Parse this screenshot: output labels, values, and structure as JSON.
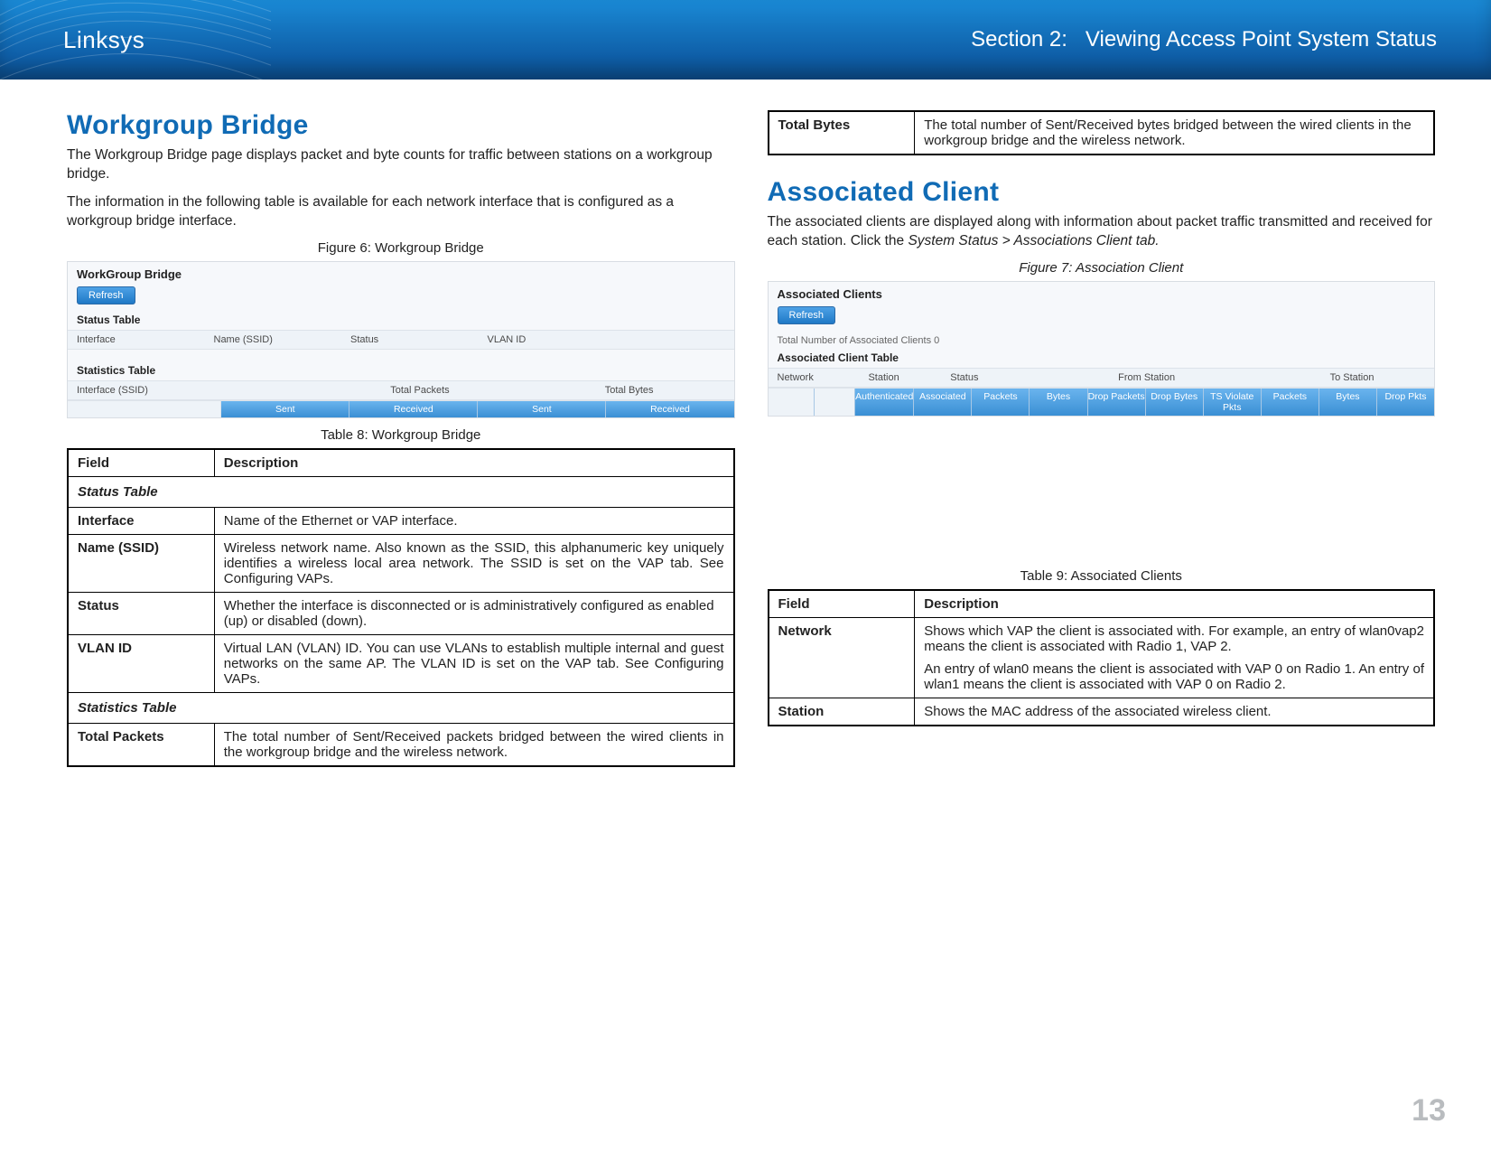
{
  "header": {
    "brand": "Linksys",
    "section_prefix": "Section 2:",
    "section_title": "Viewing Access Point System Status"
  },
  "left": {
    "heading": "Workgroup Bridge",
    "p1": "The Workgroup Bridge page displays packet and byte counts for traffic between stations on a workgroup bridge.",
    "p2": "The information in the following table is available for each network interface that is configured as a workgroup bridge interface.",
    "fig_caption": "Figure 6: Workgroup Bridge",
    "shot": {
      "title": "WorkGroup Bridge",
      "refresh": "Refresh",
      "status_title": "Status Table",
      "cols": {
        "c1": "Interface",
        "c2": "Name (SSID)",
        "c3": "Status",
        "c4": "VLAN ID"
      },
      "stats_title": "Statistics Table",
      "stats_row_label": "Interface (SSID)",
      "stats_h1": "Total Packets",
      "stats_h2": "Total Bytes",
      "pills": {
        "p1": "Sent",
        "p2": "Received",
        "p3": "Sent",
        "p4": "Received"
      }
    },
    "table_caption": "Table 8: Workgroup Bridge",
    "table": {
      "head_field": "Field",
      "head_desc": "Description",
      "section1": "Status Table",
      "rows1": [
        {
          "field": "Interface",
          "desc": "Name of the Ethernet or VAP interface."
        },
        {
          "field": "Name (SSID)",
          "desc": "Wireless network name. Also known as the SSID, this alphanumeric key uniquely identifies a wireless local area network. The SSID is set on the VAP tab. See Configuring VAPs."
        },
        {
          "field": "Status",
          "desc": "Whether the interface is disconnected or is administratively configured as enabled (up) or disabled (down)."
        },
        {
          "field": "VLAN ID",
          "desc": "Virtual LAN (VLAN) ID. You can use VLANs to establish multiple internal and guest networks on the same AP. The VLAN ID is set on the VAP tab. See Configuring VAPs."
        }
      ],
      "section2": "Statistics Table",
      "rows2": [
        {
          "field": "Total Packets",
          "desc": "The total number of Sent/Received packets bridged between the wired clients in the workgroup bridge and the wireless network."
        }
      ]
    }
  },
  "right": {
    "cont_table": {
      "field": "Total Bytes",
      "desc": "The total number of Sent/Received bytes bridged between the wired clients in the workgroup bridge and the wireless network."
    },
    "heading": "Associated Client",
    "p1_a": "The associated clients are displayed along with information about packet traffic transmitted and received for each station. Click the ",
    "p1_b": "System Status > Associations Client tab.",
    "fig_caption": "Figure 7: Association Client",
    "shot": {
      "title": "Associated Clients",
      "refresh": "Refresh",
      "note": "Total Number of Associated Clients   0",
      "sub": "Associated Client Table",
      "cols": {
        "c1": "Network",
        "c2": "Station",
        "c3": "Status",
        "c4": "From Station",
        "c5": "To Station"
      },
      "pills": [
        "Authenticated",
        "Associated",
        "Packets",
        "Bytes",
        "Drop Packets",
        "Drop Bytes",
        "TS Violate Pkts",
        "Packets",
        "Bytes",
        "Drop Pkts"
      ]
    },
    "table_caption": "Table 9: Associated Clients",
    "table": {
      "head_field": "Field",
      "head_desc": "Description",
      "rows": [
        {
          "field": "Network",
          "desc_a": "Shows which VAP the client is associated with. For example, an entry of wlan0vap2 means the client is associated with Radio 1, VAP 2.",
          "desc_b": "An entry of wlan0 means the client is associated with VAP 0 on Radio 1. An entry of wlan1 means the client is associated with VAP 0 on Radio 2."
        },
        {
          "field": "Station",
          "desc_a": "Shows the MAC address of the associated wireless client.",
          "desc_b": ""
        }
      ]
    }
  },
  "page_number": "13"
}
